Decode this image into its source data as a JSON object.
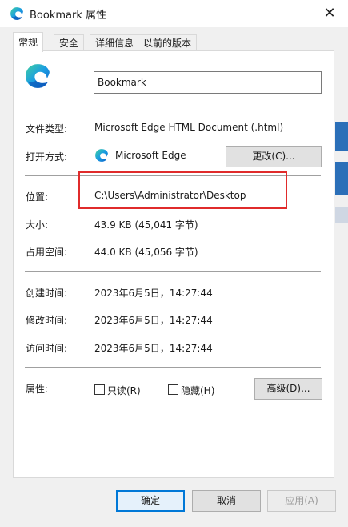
{
  "window": {
    "title": "Bookmark 属性",
    "close_glyph": "✕"
  },
  "tabs": [
    {
      "label": "常规"
    },
    {
      "label": "安全"
    },
    {
      "label": "详细信息"
    },
    {
      "label": "以前的版本"
    }
  ],
  "general": {
    "file_name": "Bookmark",
    "file_type_label": "文件类型:",
    "file_type_value": "Microsoft Edge HTML Document (.html)",
    "opens_with_label": "打开方式:",
    "opens_with_value": "Microsoft Edge",
    "change_button": "更改(C)...",
    "location_label": "位置:",
    "location_value": "C:\\Users\\Administrator\\Desktop",
    "size_label": "大小:",
    "size_value": "43.9 KB (45,041 字节)",
    "size_on_disk_label": "占用空间:",
    "size_on_disk_value": "44.0 KB (45,056 字节)",
    "created_label": "创建时间:",
    "created_value": "2023年6月5日，14:27:44",
    "modified_label": "修改时间:",
    "modified_value": "2023年6月5日，14:27:44",
    "accessed_label": "访问时间:",
    "accessed_value": "2023年6月5日，14:27:44",
    "attributes_label": "属性:",
    "readonly_label": "只读(R)",
    "hidden_label": "隐藏(H)",
    "advanced_button": "高级(D)..."
  },
  "footer": {
    "ok": "确定",
    "cancel": "取消",
    "apply": "应用(A)"
  },
  "icons": {
    "app": "edge-icon",
    "close": "close-icon"
  },
  "colors": {
    "accent": "#0078d7",
    "highlight": "#e02b2b"
  }
}
